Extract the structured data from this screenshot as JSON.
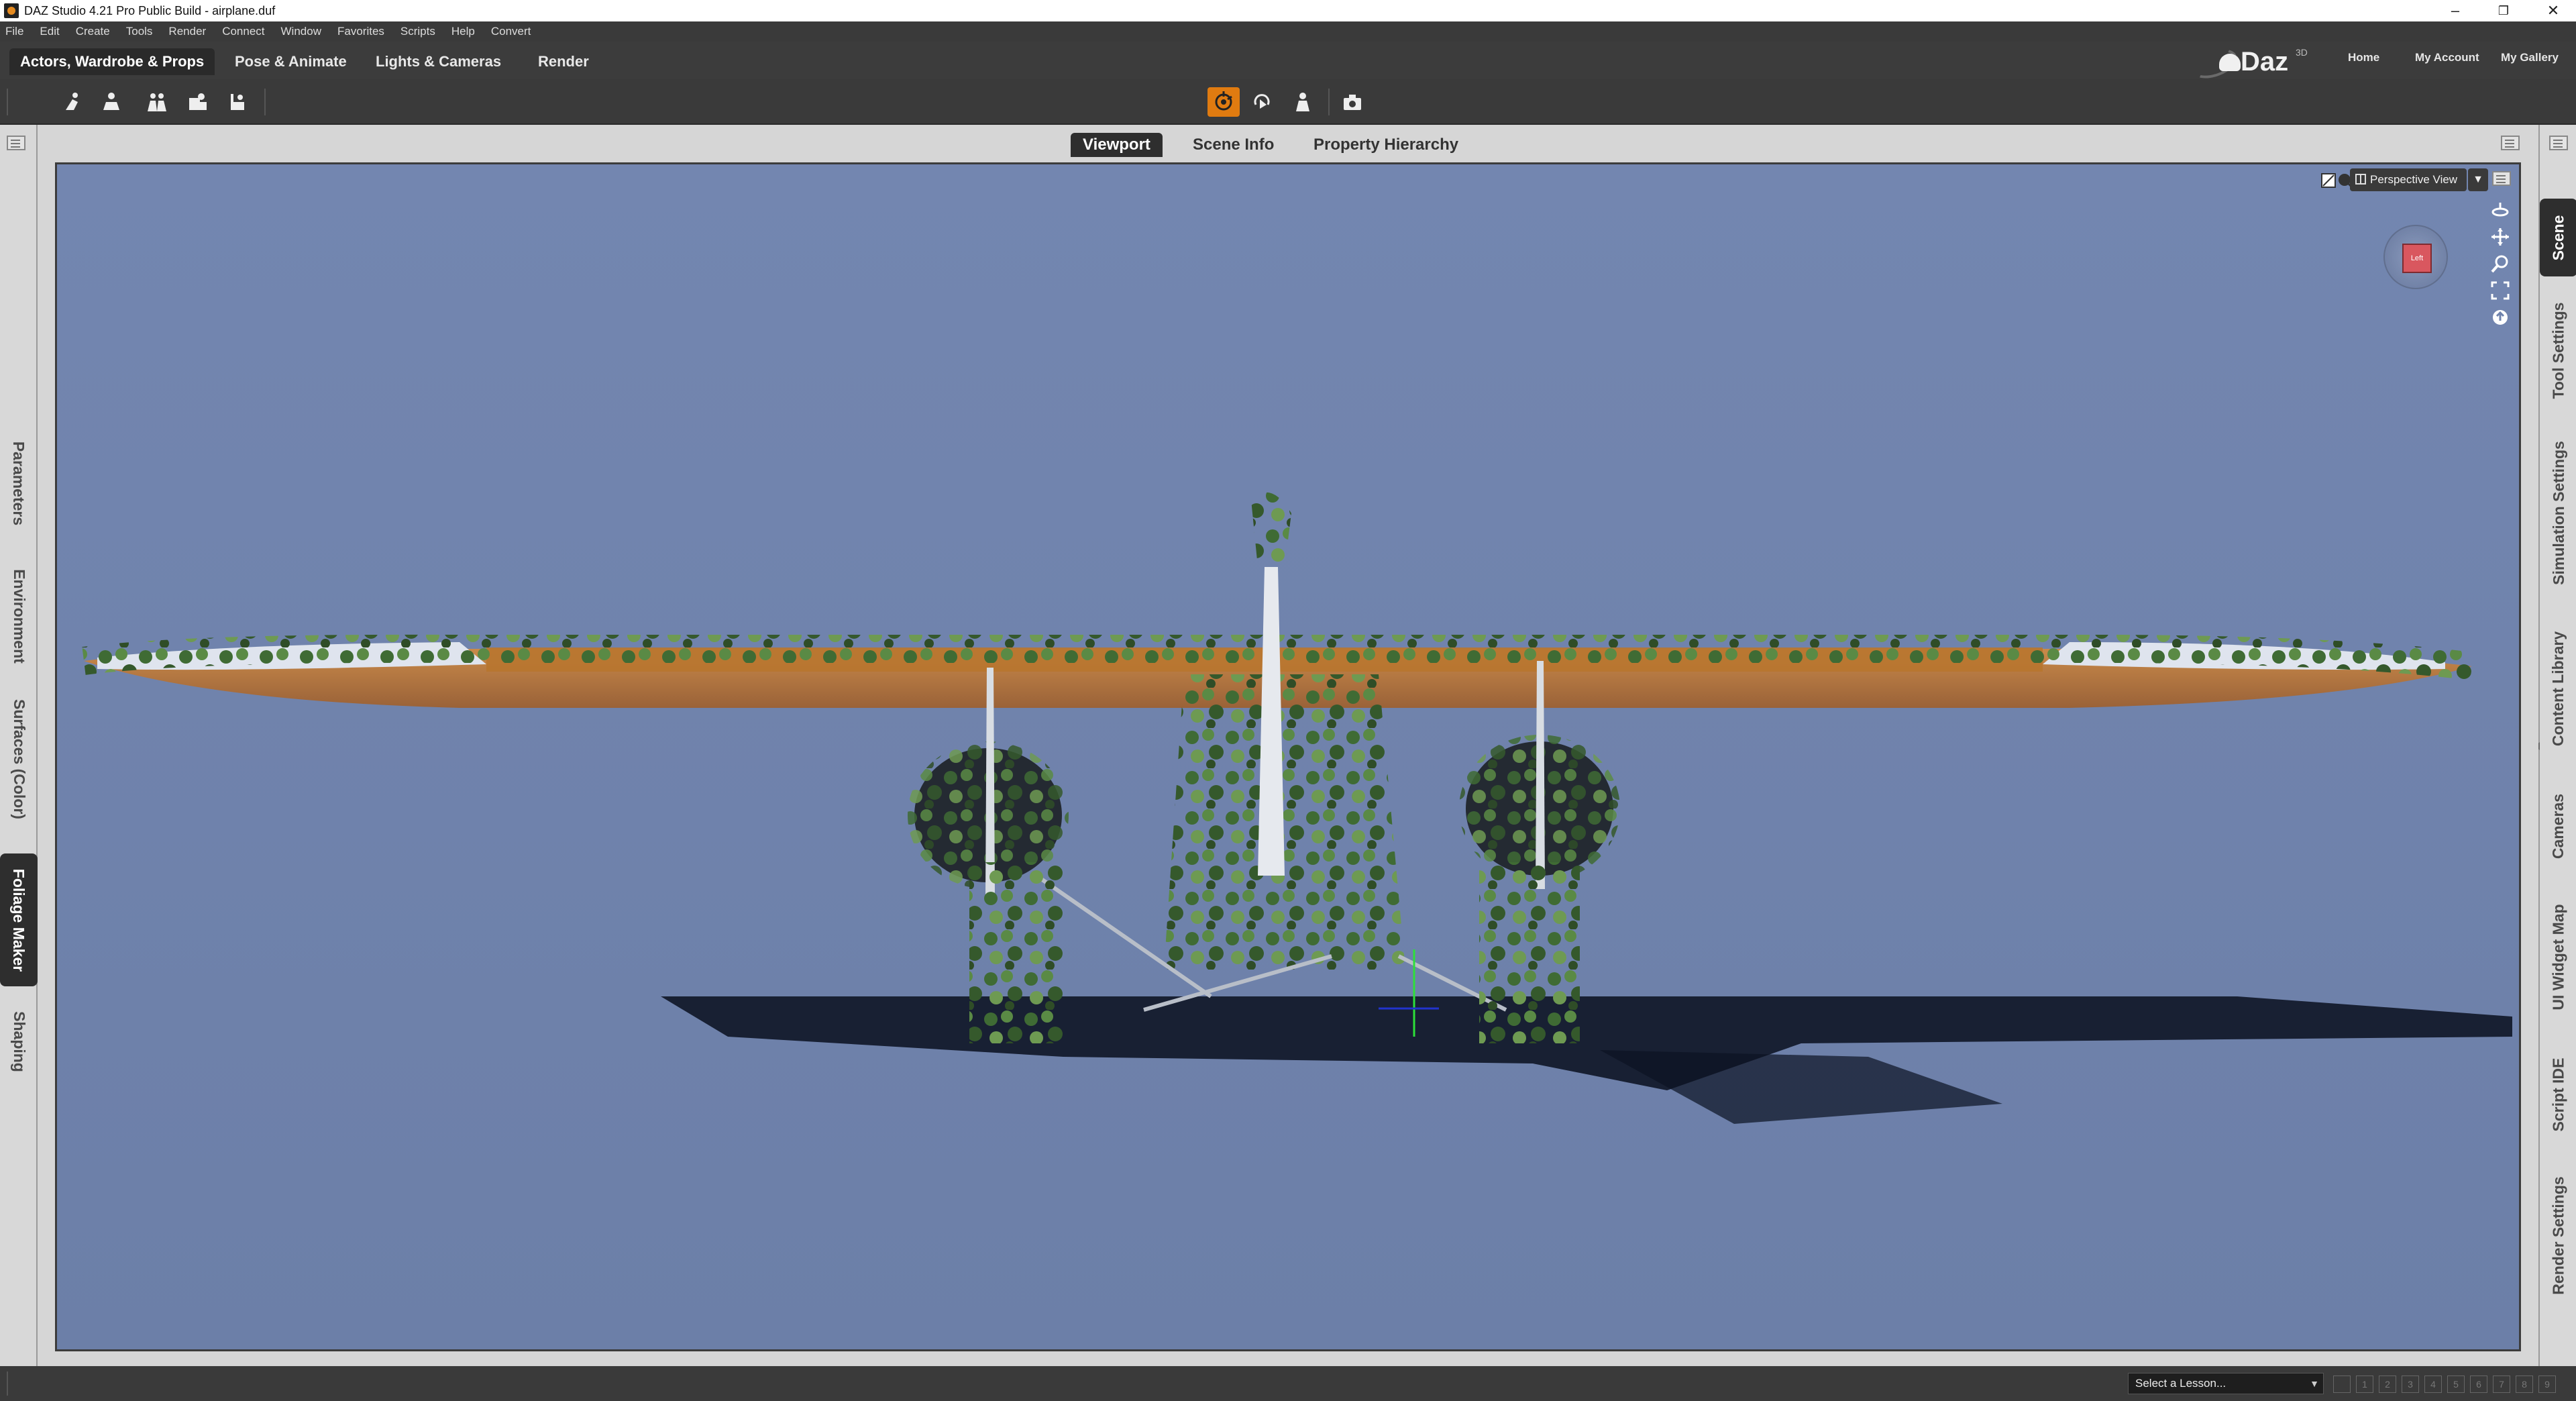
{
  "window": {
    "title": "DAZ Studio 4.21 Pro Public Build - airplane.duf"
  },
  "menu": [
    "File",
    "Edit",
    "Create",
    "Tools",
    "Render",
    "Connect",
    "Window",
    "Favorites",
    "Scripts",
    "Help",
    "Convert"
  ],
  "pane_tabs": [
    "Actors, Wardrobe & Props",
    "Pose & Animate",
    "Lights & Cameras",
    "Render"
  ],
  "brand": {
    "logo_text": "Daz",
    "logo_sup": "3D",
    "links": [
      "Home",
      "My Account",
      "My Gallery"
    ]
  },
  "toolbar": {
    "left_tools": [
      "figure-add-icon",
      "pose-icon",
      "group-icon",
      "wardrobe-icon",
      "prop-icon"
    ],
    "center_tools": [
      "universal-tool-icon",
      "rotate-tool-icon",
      "figure-tool-icon",
      "camera-tool-icon"
    ],
    "active_tool": "universal-tool-icon",
    "accent": "#e07b10"
  },
  "left_tabs": [
    "Parameters",
    "Environment",
    "Surfaces (Color)",
    "Foliage Maker",
    "Shaping"
  ],
  "left_active": "Foliage Maker",
  "right_tabs": [
    "Scene",
    "Tool Settings",
    "Simulation Settings",
    "Content Library",
    "Cameras",
    "UI Widget Map",
    "Script IDE",
    "Render Settings"
  ],
  "right_active": "Scene",
  "viewport_tabs": [
    "Viewport",
    "Scene Info",
    "Property Hierarchy"
  ],
  "viewport": {
    "camera": "Perspective View",
    "cube_face": "Left",
    "bg_color": "#6e82ad",
    "nav_icons": [
      "orbit-icon",
      "pan-icon",
      "zoom-icon",
      "frame-icon",
      "reset-icon"
    ]
  },
  "status": {
    "lesson_placeholder": "Select a Lesson...",
    "steps": [
      "1",
      "2",
      "3",
      "4",
      "5",
      "6",
      "7",
      "8",
      "9"
    ]
  }
}
